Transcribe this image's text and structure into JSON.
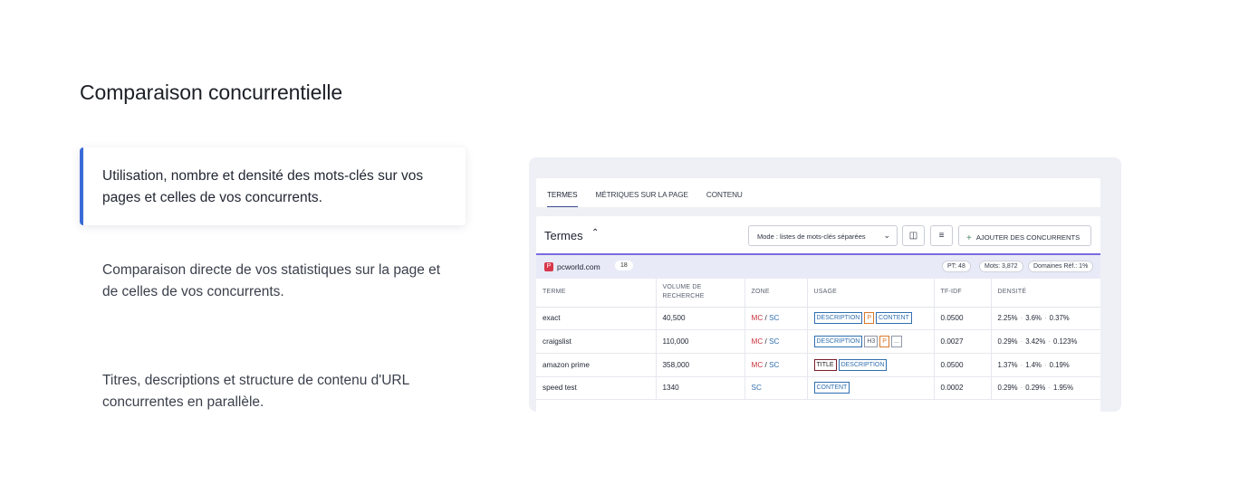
{
  "section": {
    "title": "Comparaison concurrentielle"
  },
  "features": [
    {
      "text": "Utilisation, nombre et densité des mots-clés sur vos pages et celles de vos concurrents.",
      "active": true
    },
    {
      "text": "Comparaison directe de vos statistiques sur la page et de celles de vos concurrents.",
      "active": false
    },
    {
      "text": "Titres, descriptions et structure de contenu d'URL concurrentes en parallèle.",
      "active": false
    }
  ],
  "screenshot": {
    "tabs": [
      "TERMES",
      "MÉTRIQUES SUR LA PAGE",
      "CONTENU"
    ],
    "panel_title": "Termes",
    "mode_select": "Mode : listes de mots-clés séparées",
    "add_button": "AJOUTER DES CONCURRENTS",
    "domain": {
      "name": "pcworld.com",
      "count": "18",
      "favicon_letter": "P"
    },
    "pills": [
      "PT: 48",
      "Mots: 3,872",
      "Domaines Réf.: 1%"
    ],
    "columns": [
      "TERME",
      "VOLUME DE RECHERCHE",
      "ZONE",
      "USAGE",
      "TF-IDF",
      "DENSITÉ"
    ],
    "rows": [
      {
        "term": "exact",
        "volume": "40,500",
        "zone_mc": "MC",
        "zone_sc": "SC",
        "tags": [
          "DESCRIPTION",
          "P",
          "CONTENT"
        ],
        "tfidf": "0.0500",
        "density": [
          "2.25%",
          "3.6%",
          "0.37%"
        ]
      },
      {
        "term": "craigslist",
        "volume": "110,000",
        "zone_mc": "MC",
        "zone_sc": "SC",
        "tags": [
          "DESCRIPTION",
          "H3",
          "P",
          "..."
        ],
        "tfidf": "0.0027",
        "density": [
          "0.29%",
          "3.42%",
          "0.123%"
        ]
      },
      {
        "term": "amazon prime",
        "volume": "358,000",
        "zone_mc": "MC",
        "zone_sc": "SC",
        "tags": [
          "TITLE",
          "DESCRIPTION"
        ],
        "tfidf": "0.0500",
        "density": [
          "1.37%",
          "1.4%",
          "0.19%"
        ]
      },
      {
        "term": "speed test",
        "volume": "1340",
        "zone_mc": "",
        "zone_sc": "SC",
        "tags": [
          "CONTENT"
        ],
        "tfidf": "0.0002",
        "density": [
          "0.29%",
          "0.29%",
          "1.95%"
        ]
      }
    ]
  }
}
